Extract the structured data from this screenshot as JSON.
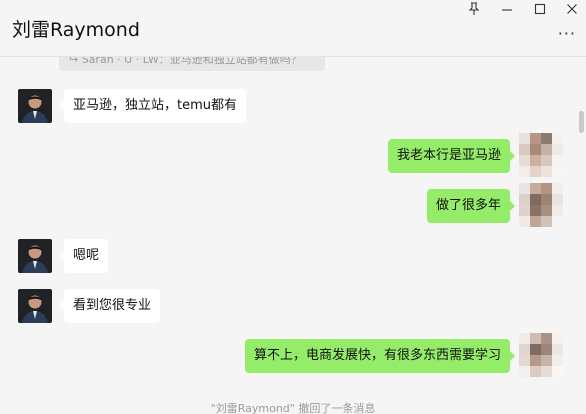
{
  "header": {
    "title": "刘雷Raymond",
    "more_label": "···"
  },
  "window_controls": {
    "pin_icon": "pin-icon",
    "minimize_icon": "minimize-icon",
    "maximize_icon": "maximize-icon",
    "close_icon": "close-icon"
  },
  "quote": {
    "text": "↪ Sarah · U · LW：亚马逊和独立站都有做吗？"
  },
  "messages": [
    {
      "side": "left",
      "text": "亚马逊，独立站，temu都有"
    },
    {
      "side": "right",
      "text": "我老本行是亚马逊"
    },
    {
      "side": "right",
      "text": "做了很多年"
    },
    {
      "side": "left",
      "text": "嗯呢"
    },
    {
      "side": "left",
      "text": "看到您很专业"
    },
    {
      "side": "right",
      "text": "算不上，电商发展快，有很多东西需要学习"
    }
  ],
  "recall_notice": "\"刘雷Raymond\" 撤回了一条消息",
  "colors": {
    "bg": "#f5f5f5",
    "bubble_self": "#95ec69",
    "bubble_other": "#ffffff"
  }
}
